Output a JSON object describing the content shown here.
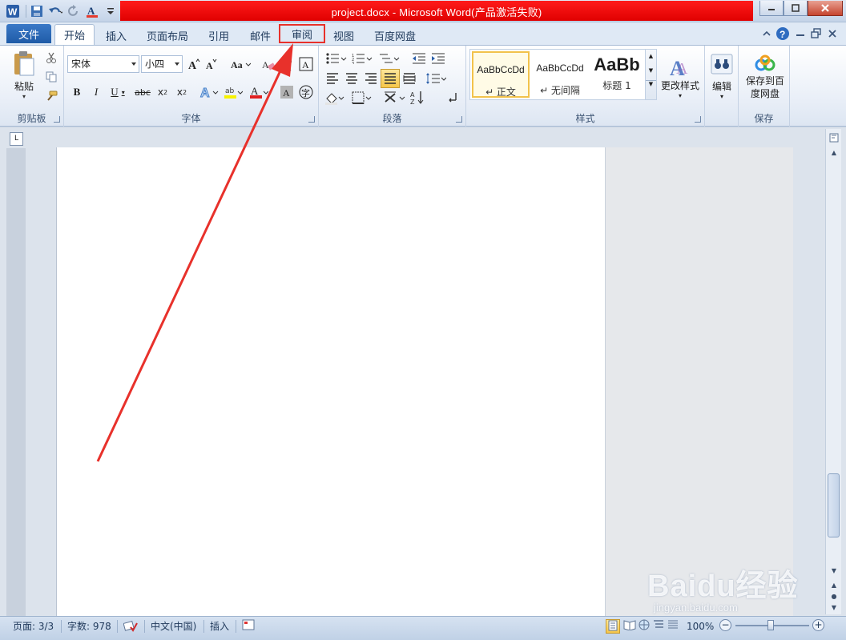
{
  "window": {
    "title": "project.docx - Microsoft Word(产品激活失败)"
  },
  "tabs": {
    "file": "文件",
    "items": [
      "开始",
      "插入",
      "页面布局",
      "引用",
      "邮件",
      "审阅",
      "视图",
      "百度网盘"
    ]
  },
  "ribbon": {
    "clipboard": {
      "label": "剪贴板",
      "paste": "粘贴"
    },
    "font": {
      "label": "字体",
      "font_name": "宋体",
      "font_size": "小四"
    },
    "paragraph": {
      "label": "段落"
    },
    "styles": {
      "label": "样式",
      "items": [
        {
          "preview": "AaBbCcDd",
          "name": "↵ 正文"
        },
        {
          "preview": "AaBbCcDd",
          "name": "↵ 无间隔"
        },
        {
          "preview": "AaBb",
          "name": "标题 1"
        }
      ],
      "change_styles": "更改样式"
    },
    "editing": {
      "label": "编辑"
    },
    "save": {
      "label": "保存",
      "button": "保存到百度网盘"
    }
  },
  "statusbar": {
    "page": "页面: 3/3",
    "words": "字数: 978",
    "language": "中文(中国)",
    "mode": "插入",
    "zoom": "100%"
  },
  "watermark": {
    "main": "Baidu经验",
    "sub": "jingyan.baidu.com"
  },
  "colors": {
    "title_highlight": "#e00000",
    "annotation": "#e8312b",
    "file_tab": "#2a67b6"
  }
}
